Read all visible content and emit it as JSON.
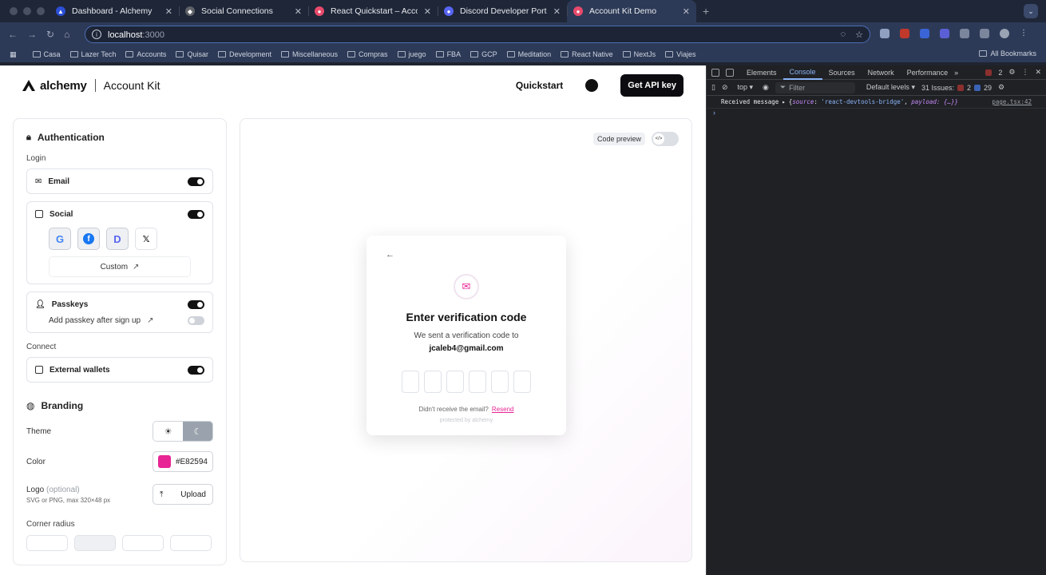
{
  "browser": {
    "tabs": [
      {
        "title": "Dashboard - Alchemy",
        "color": "#2c4fd6",
        "active": false
      },
      {
        "title": "Social Connections",
        "color": "#ffffff",
        "active": false
      },
      {
        "title": "React Quickstart – Account Kit",
        "color": "#e84a6b",
        "active": false
      },
      {
        "title": "Discord Developer Portal — My Applications",
        "color": "#5865f2",
        "active": false
      },
      {
        "title": "Account Kit Demo",
        "color": "#e84a6b",
        "active": true
      }
    ],
    "url_host": "localhost",
    "url_port": ":3000",
    "bookmarks": [
      "Casa",
      "Lazer Tech",
      "Accounts",
      "Quisar",
      "Development",
      "Miscellaneous",
      "Compras",
      "juego",
      "FBA",
      "GCP",
      "Meditation",
      "React Native",
      "NextJs",
      "Viajes"
    ],
    "all_bookmarks": "All Bookmarks"
  },
  "header": {
    "logo_word": "alchemy",
    "product": "Account Kit",
    "quickstart": "Quickstart",
    "api_button": "Get API key"
  },
  "sidebar": {
    "authentication": {
      "title": "Authentication",
      "login_label": "Login",
      "email": "Email",
      "social": "Social",
      "social_providers": [
        "G",
        "f",
        "D",
        "𝕏"
      ],
      "custom": "Custom",
      "passkeys": "Passkeys",
      "add_passkey": "Add passkey after sign up",
      "connect_label": "Connect",
      "external_wallets": "External wallets"
    },
    "branding": {
      "title": "Branding",
      "theme": "Theme",
      "color": "Color",
      "color_value": "#E82594",
      "logo": "Logo",
      "logo_hint": "(optional)",
      "logo_spec": "SVG or PNG, max 320×48 px",
      "upload": "Upload",
      "corner_radius": "Corner radius"
    }
  },
  "preview": {
    "code_preview": "Code preview",
    "modal": {
      "title": "Enter verification code",
      "message": "We sent a verification code to",
      "email": "jcaleb4@gmail.com",
      "no_email": "Didn't receive the email?",
      "resend": "Resend",
      "protected": "protected by  alchemy"
    }
  },
  "devtools": {
    "tabs": [
      "Elements",
      "Console",
      "Sources",
      "Network",
      "Performance"
    ],
    "active_tab": "Console",
    "context": "top",
    "filter_placeholder": "Filter",
    "levels": "Default levels",
    "issues_label": "31 Issues:",
    "issues_red": "2",
    "issues_blue": "29",
    "error_count": "2",
    "log_prefix": "Received message",
    "log_source_key": "source",
    "log_source_val": "'react-devtools-bridge'",
    "log_payload": "payload: {…}}",
    "log_file": "page.tsx:42"
  },
  "colors": {
    "accent": "#E82594",
    "chrome": "#2d3a57"
  }
}
